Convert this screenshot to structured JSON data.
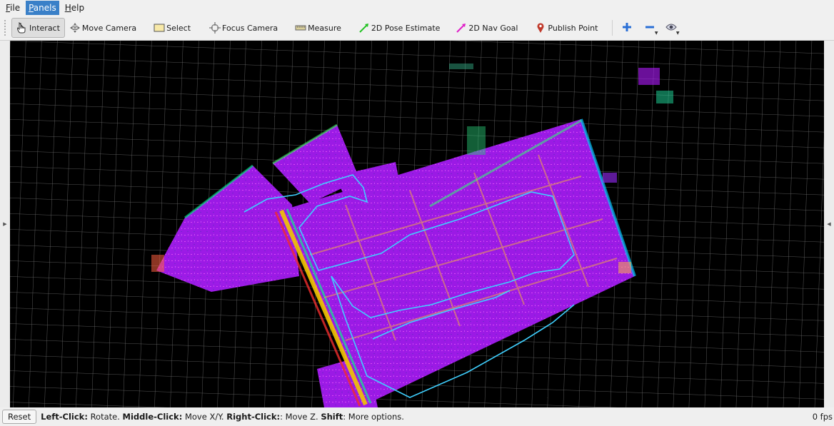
{
  "menubar": {
    "items": [
      {
        "label": "File",
        "underline": "F",
        "rest": "ile",
        "active": false
      },
      {
        "label": "Panels",
        "underline": "P",
        "rest": "anels",
        "active": true
      },
      {
        "label": "Help",
        "underline": "H",
        "rest": "elp",
        "active": false
      }
    ]
  },
  "toolbar": {
    "interact": "Interact",
    "move_camera": "Move Camera",
    "select": "Select",
    "focus_camera": "Focus Camera",
    "measure": "Measure",
    "pose_estimate": "2D Pose Estimate",
    "nav_goal": "2D Nav Goal",
    "publish_point": "Publish Point"
  },
  "icons": {
    "interact": "hand-pointer-icon",
    "move_camera": "move-camera-icon",
    "select": "select-rectangle-icon",
    "focus_camera": "focus-crosshair-icon",
    "measure": "ruler-icon",
    "pose_estimate": "green-arrow-icon",
    "nav_goal": "magenta-arrow-icon",
    "publish_point": "map-pin-icon",
    "add": "plus-icon",
    "remove": "minus-icon",
    "view": "eye-icon"
  },
  "colors": {
    "menu_active": "#3a80c8",
    "pose_estimate": "#22c222",
    "nav_goal": "#e020c8",
    "publish_point": "#c0392b",
    "plus_minus": "#2a6fd6",
    "path": "#3fd0ff",
    "cloud": "#b01aff"
  },
  "status": {
    "reset_label": "Reset",
    "hint_parts": [
      {
        "text": "Left-Click:",
        "bold": true
      },
      {
        "text": " Rotate. ",
        "bold": false
      },
      {
        "text": "Middle-Click:",
        "bold": true
      },
      {
        "text": " Move X/Y. ",
        "bold": false
      },
      {
        "text": "Right-Click:",
        "bold": true
      },
      {
        "text": ": Move Z. ",
        "bold": false
      },
      {
        "text": "Shift",
        "bold": true
      },
      {
        "text": ": More options.",
        "bold": false
      }
    ],
    "fps": "0 fps"
  }
}
